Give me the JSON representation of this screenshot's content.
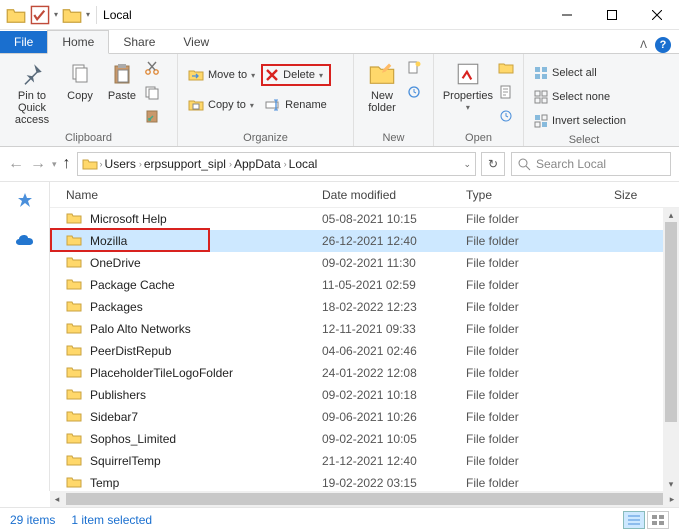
{
  "titlebar": {
    "title": "Local"
  },
  "tabs": {
    "file": "File",
    "home": "Home",
    "share": "Share",
    "view": "View"
  },
  "ribbon": {
    "clipboard": {
      "pin": "Pin to Quick\naccess",
      "copy": "Copy",
      "paste": "Paste",
      "label": "Clipboard"
    },
    "organize": {
      "moveto": "Move to",
      "copyto": "Copy to",
      "delete": "Delete",
      "rename": "Rename",
      "label": "Organize"
    },
    "new": {
      "newfolder": "New\nfolder",
      "label": "New"
    },
    "open": {
      "properties": "Properties",
      "label": "Open"
    },
    "select": {
      "selectall": "Select all",
      "selectnone": "Select none",
      "invert": "Invert selection",
      "label": "Select"
    }
  },
  "breadcrumbs": [
    "Users",
    "erpsupport_sipl",
    "AppData",
    "Local"
  ],
  "search": {
    "placeholder": "Search Local"
  },
  "columns": {
    "name": "Name",
    "date": "Date modified",
    "type": "Type",
    "size": "Size"
  },
  "rows": [
    {
      "name": "Microsoft Help",
      "date": "05-08-2021 10:15",
      "type": "File folder"
    },
    {
      "name": "Mozilla",
      "date": "26-12-2021 12:40",
      "type": "File folder",
      "selected": true,
      "highlight": true
    },
    {
      "name": "OneDrive",
      "date": "09-02-2021 11:30",
      "type": "File folder"
    },
    {
      "name": "Package Cache",
      "date": "11-05-2021 02:59",
      "type": "File folder"
    },
    {
      "name": "Packages",
      "date": "18-02-2022 12:23",
      "type": "File folder"
    },
    {
      "name": "Palo Alto Networks",
      "date": "12-11-2021 09:33",
      "type": "File folder"
    },
    {
      "name": "PeerDistRepub",
      "date": "04-06-2021 02:46",
      "type": "File folder"
    },
    {
      "name": "PlaceholderTileLogoFolder",
      "date": "24-01-2022 12:08",
      "type": "File folder"
    },
    {
      "name": "Publishers",
      "date": "09-02-2021 10:18",
      "type": "File folder"
    },
    {
      "name": "Sidebar7",
      "date": "09-06-2021 10:26",
      "type": "File folder"
    },
    {
      "name": "Sophos_Limited",
      "date": "09-02-2021 10:05",
      "type": "File folder"
    },
    {
      "name": "SquirrelTemp",
      "date": "21-12-2021 12:40",
      "type": "File folder"
    },
    {
      "name": "Temp",
      "date": "19-02-2022 03:15",
      "type": "File folder"
    }
  ],
  "status": {
    "count": "29 items",
    "selection": "1 item selected"
  },
  "colors": {
    "accent": "#1a6fcf",
    "highlight": "#d8221f",
    "selection": "#cde8ff"
  }
}
